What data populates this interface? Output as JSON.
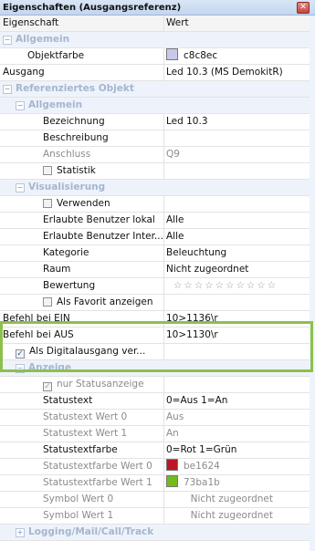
{
  "window": {
    "title": "Eigenschaften (Ausgangsreferenz)"
  },
  "header": {
    "col_property": "Eigenschaft",
    "col_value": "Wert"
  },
  "sections": {
    "allgemein": "Allgemein",
    "referenziertes": "Referenziertes Objekt",
    "ref_allgemein": "Allgemein",
    "visualisierung": "Visualisierung",
    "anzeige": "Anzeige",
    "logging": "Logging/Mail/Call/Track"
  },
  "rows": {
    "objektfarbe": {
      "label": "Objektfarbe",
      "value": "c8c8ec",
      "color": "#c8c8ec"
    },
    "ausgang": {
      "label": "Ausgang",
      "value": "Led 10.3 (MS DemokitR)"
    },
    "bezeichnung": {
      "label": "Bezeichnung",
      "value": "Led 10.3"
    },
    "beschreibung": {
      "label": "Beschreibung",
      "value": ""
    },
    "anschluss": {
      "label": "Anschluss",
      "value": "Q9"
    },
    "statistik": {
      "label": "Statistik",
      "checked": false
    },
    "verwenden": {
      "label": "Verwenden",
      "checked": false
    },
    "benutzer_lokal": {
      "label": "Erlaubte Benutzer lokal",
      "value": "Alle"
    },
    "benutzer_inter": {
      "label": "Erlaubte Benutzer Inter...",
      "value": "Alle"
    },
    "kategorie": {
      "label": "Kategorie",
      "value": "Beleuchtung"
    },
    "raum": {
      "label": "Raum",
      "value": "Nicht zugeordnet"
    },
    "bewertung": {
      "label": "Bewertung",
      "value": "☆☆☆☆☆☆☆☆☆☆"
    },
    "favorit": {
      "label": "Als Favorit anzeigen",
      "checked": false
    },
    "befehl_ein": {
      "label": "Befehl bei EIN",
      "value": "10>1136\\r"
    },
    "befehl_aus": {
      "label": "Befehl bei AUS",
      "value": "10>1130\\r"
    },
    "digitalausgang": {
      "label": "Als Digitalausgang ver...",
      "checked": true
    },
    "nur_status": {
      "label": "nur Statusanzeige",
      "checked": true
    },
    "statustext": {
      "label": "Statustext",
      "value": "0=Aus 1=An"
    },
    "statustext_0": {
      "label": "Statustext Wert 0",
      "value": "Aus"
    },
    "statustext_1": {
      "label": "Statustext Wert 1",
      "value": "An"
    },
    "statustextfarbe": {
      "label": "Statustextfarbe",
      "value": "0=Rot 1=Grün"
    },
    "statusfarbe_0": {
      "label": "Statustextfarbe Wert 0",
      "value": "be1624",
      "color": "#be1624"
    },
    "statusfarbe_1": {
      "label": "Statustextfarbe Wert 1",
      "value": "73ba1b",
      "color": "#73ba1b"
    },
    "symbol_0": {
      "label": "Symbol Wert 0",
      "value": "Nicht zugeordnet"
    },
    "symbol_1": {
      "label": "Symbol Wert 1",
      "value": "Nicht zugeordnet"
    }
  },
  "colors": {
    "highlight_frame": "#8cc04d",
    "category_bg": "#eef3fb"
  }
}
